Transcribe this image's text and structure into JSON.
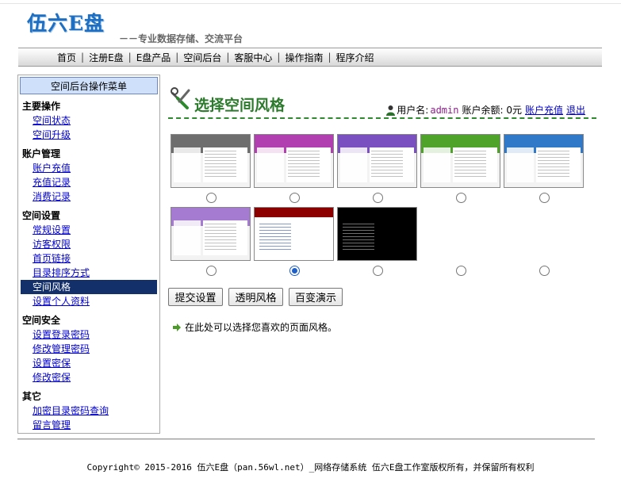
{
  "brand": {
    "logo": "伍六E盘",
    "slogan": "－－专业数据存储、交流平台"
  },
  "nav": [
    "首页",
    "注册E盘",
    "E盘产品",
    "空间后台",
    "客服中心",
    "操作指南",
    "程序介绍"
  ],
  "sidebar": {
    "header": "空间后台操作菜单",
    "groups": [
      {
        "title": "主要操作",
        "items": [
          "空间状态",
          "空间升级"
        ]
      },
      {
        "title": "账户管理",
        "items": [
          "账户充值",
          "充值记录",
          "消费记录"
        ]
      },
      {
        "title": "空间设置",
        "items": [
          "常规设置",
          "访客权限",
          "首页链接",
          "目录排序方式",
          "空间风格",
          "设置个人资料"
        ]
      },
      {
        "title": "空间安全",
        "items": [
          "设置登录密码",
          "修改管理密码",
          "设置密保",
          "修改密保"
        ]
      },
      {
        "title": "其它",
        "items": [
          "加密目录密码查询",
          "留言管理"
        ]
      }
    ],
    "active": "空间风格"
  },
  "content": {
    "title": "选择空间风格",
    "user_label": "用户名:",
    "username": "admin",
    "balance": "账户余额: 0元",
    "recharge_link": "账户充值",
    "logout_link": "退出"
  },
  "themes": {
    "selected_index": 6,
    "colors": [
      "#6e6e6e",
      "#b23fb0",
      "#7a4fbf",
      "#4fa32a",
      "#2f79c8",
      "#a47bd0",
      "#8c0000",
      "#111111"
    ]
  },
  "buttons": {
    "submit": "提交设置",
    "transparent": "透明风格",
    "demo": "百变演示"
  },
  "hint": "在此处可以选择您喜欢的页面风格。",
  "footer": {
    "copyright": "Copyright© 2015-2016 伍六E盘（pan.56wl.net）_网络存储系统 伍六E盘工作室版权所有，并保留所有权利"
  }
}
